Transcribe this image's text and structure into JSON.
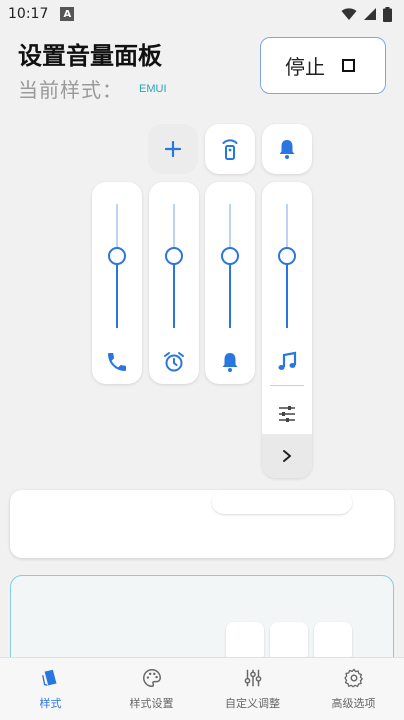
{
  "status_bar": {
    "time": "10:17",
    "notification_icon": "a-badge-icon",
    "wifi_icon": "wifi-icon",
    "signal_icon": "signal-icon",
    "battery_icon": "battery-icon"
  },
  "header": {
    "title": "设置音量面板",
    "current_style_label": "当前样式：",
    "current_style_value": "EMUI"
  },
  "stop_button": {
    "label": "停止"
  },
  "panel": {
    "top_buttons": [
      {
        "name": "add",
        "icon": "plus-icon"
      },
      {
        "name": "remote",
        "icon": "remote-icon"
      },
      {
        "name": "notification",
        "icon": "bell-icon"
      }
    ],
    "sliders": [
      {
        "name": "call",
        "icon": "phone-icon",
        "level": 0.58
      },
      {
        "name": "alarm",
        "icon": "alarm-clock-icon",
        "level": 0.58
      },
      {
        "name": "ring",
        "icon": "bell-icon",
        "level": 0.58
      },
      {
        "name": "media",
        "icon": "music-note-icon",
        "level": 0.58
      }
    ],
    "settings_icon": "tune-icon",
    "expand_icon": "chevron-right-icon"
  },
  "bottom_nav": {
    "items": [
      {
        "label": "样式",
        "icon": "style-icon",
        "active": true
      },
      {
        "label": "样式设置",
        "icon": "palette-icon",
        "active": false
      },
      {
        "label": "自定义调整",
        "icon": "sliders-icon",
        "active": false
      },
      {
        "label": "高级选项",
        "icon": "gear-icon",
        "active": false
      }
    ]
  },
  "colors": {
    "accent": "#2a76e0",
    "teal": "#2aa5b8",
    "background": "#f1f1f1"
  }
}
